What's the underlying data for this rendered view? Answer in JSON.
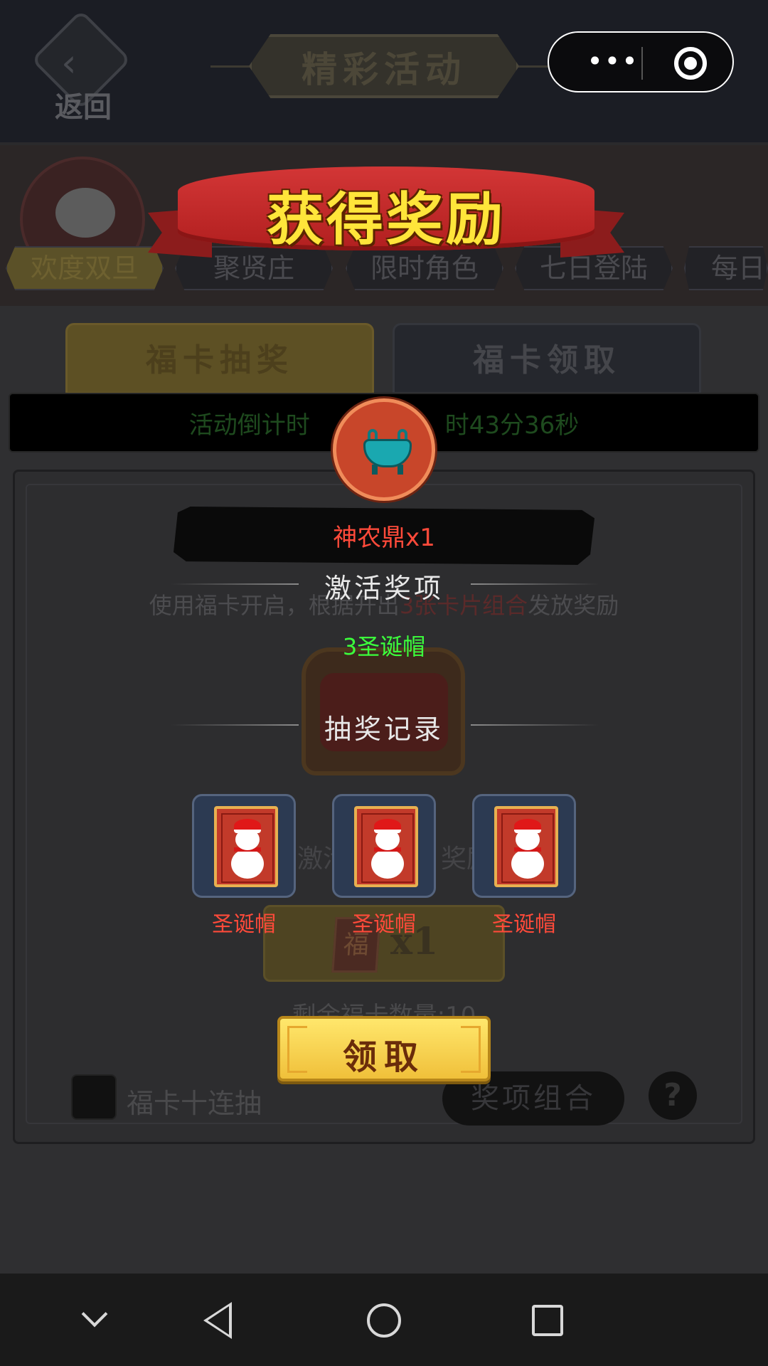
{
  "header": {
    "back_label": "返回",
    "title": "精彩活动",
    "capsule_more_icon": "more-dots-icon",
    "capsule_target_icon": "target-icon"
  },
  "activity_tabs": [
    {
      "label": "欢度双旦",
      "active": true
    },
    {
      "label": "聚贤庄",
      "active": false
    },
    {
      "label": "限时角色",
      "active": false
    },
    {
      "label": "七日登陆",
      "active": false
    },
    {
      "label": "每日",
      "active": false
    }
  ],
  "sub_tabs": {
    "left": "福卡抽奖",
    "right": "福卡领取"
  },
  "countdown": "活动倒计时",
  "countdown_tail": "时43分36秒",
  "panel": {
    "description_pre": "使用福卡开启，根据开出",
    "description_hl": "3张卡片组合",
    "description_post": "发放奖励",
    "activate_text": "激活",
    "activate_text_tail": "奖励",
    "fuka_icon": "福",
    "fuka_count": "x1",
    "remaining": "剩余福卡数量:10",
    "ten_draw_label": "福卡十连抽",
    "combo_button": "奖项组合",
    "help_button": "?"
  },
  "modal": {
    "banner_title": "获得奖励",
    "prize_icon": "cauldron-icon",
    "prize_name": "神农鼎x1",
    "section_activate": "激活奖项",
    "combo_result": "3圣诞帽",
    "section_record": "抽奖记录",
    "cards": [
      {
        "label": "圣诞帽"
      },
      {
        "label": "圣诞帽"
      },
      {
        "label": "圣诞帽"
      }
    ],
    "claim_button": "领取"
  },
  "colors": {
    "accent_gold": "#ffe53a",
    "banner_red": "#c62828",
    "prize_red": "#ff4a3a",
    "combo_green": "#3cff3c"
  }
}
